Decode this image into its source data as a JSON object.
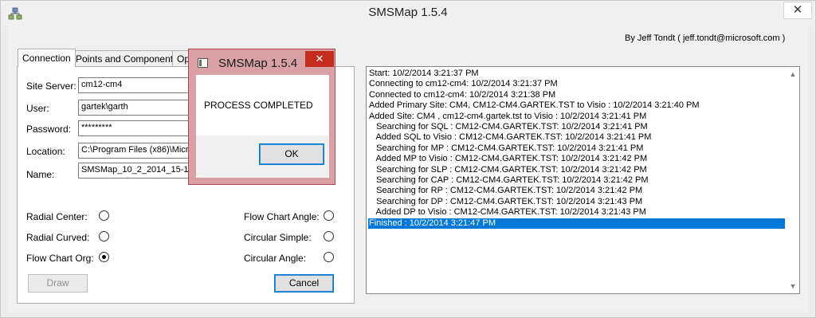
{
  "window": {
    "title": "SMSMap 1.5.4",
    "close_glyph": "✕",
    "app_icon": "network-app-icon",
    "byline": "By Jeff Tondt ( jeff.tondt@microsoft.com )"
  },
  "tabs": [
    {
      "label": "Connection",
      "active": true
    },
    {
      "label": "Points and Components",
      "active": false
    },
    {
      "label": "Op",
      "active": false
    }
  ],
  "form": {
    "site_server": {
      "label": "Site Server:",
      "value": "cm12-cm4"
    },
    "user": {
      "label": "User:",
      "value": "gartek\\garth"
    },
    "password": {
      "label": "Password:",
      "value": "*********"
    },
    "location": {
      "label": "Location:",
      "value": "C:\\Program Files (x86)\\Micro"
    },
    "name": {
      "label": "Name:",
      "value": "SMSMap_10_2_2014_15-13"
    }
  },
  "layouts": {
    "radial_center": {
      "label": "Radial Center:",
      "selected": false
    },
    "radial_curved": {
      "label": "Radial Curved:",
      "selected": false
    },
    "flow_chart_org": {
      "label": "Flow Chart Org:",
      "selected": true
    },
    "flow_chart_angle": {
      "label": "Flow Chart Angle:",
      "selected": false
    },
    "circular_simple": {
      "label": "Circular Simple:",
      "selected": false
    },
    "circular_angle": {
      "label": "Circular Angle:",
      "selected": false
    }
  },
  "buttons": {
    "draw": "Draw",
    "cancel": "Cancel"
  },
  "log": {
    "lines": [
      "Start: 10/2/2014 3:21:37 PM",
      "Connecting to cm12-cm4: 10/2/2014 3:21:37 PM",
      "Connected to cm12-cm4: 10/2/2014 3:21:38 PM",
      "Added Primary Site: CM4, CM12-CM4.GARTEK.TST to Visio : 10/2/2014 3:21:40 PM",
      "Added Site: CM4 , cm12-cm4.gartek.tst to Visio : 10/2/2014 3:21:41 PM",
      "   Searching for SQL : CM12-CM4.GARTEK.TST: 10/2/2014 3:21:41 PM",
      "   Added SQL to Visio : CM12-CM4.GARTEK.TST: 10/2/2014 3:21:41 PM",
      "   Searching for MP : CM12-CM4.GARTEK.TST: 10/2/2014 3:21:41 PM",
      "   Added MP to Visio : CM12-CM4.GARTEK.TST: 10/2/2014 3:21:42 PM",
      "   Searching for SLP : CM12-CM4.GARTEK.TST: 10/2/2014 3:21:42 PM",
      "   Searching for CAP : CM12-CM4.GARTEK.TST: 10/2/2014 3:21:42 PM",
      "   Searching for RP : CM12-CM4.GARTEK.TST: 10/2/2014 3:21:42 PM",
      "   Searching for DP : CM12-CM4.GARTEK.TST: 10/2/2014 3:21:43 PM",
      "   Added DP to Visio : CM12-CM4.GARTEK.TST: 10/2/2014 3:21:43 PM",
      "Finished : 10/2/2014 3:21:47 PM"
    ],
    "selected_index": 14
  },
  "dialog": {
    "title": "SMSMap 1.5.4",
    "message": "PROCESS COMPLETED",
    "ok": "OK",
    "close_glyph": "✕"
  },
  "colors": {
    "selection": "#0078d7",
    "dialog_frame": "#b04651",
    "dialog_close": "#c42b1c"
  }
}
